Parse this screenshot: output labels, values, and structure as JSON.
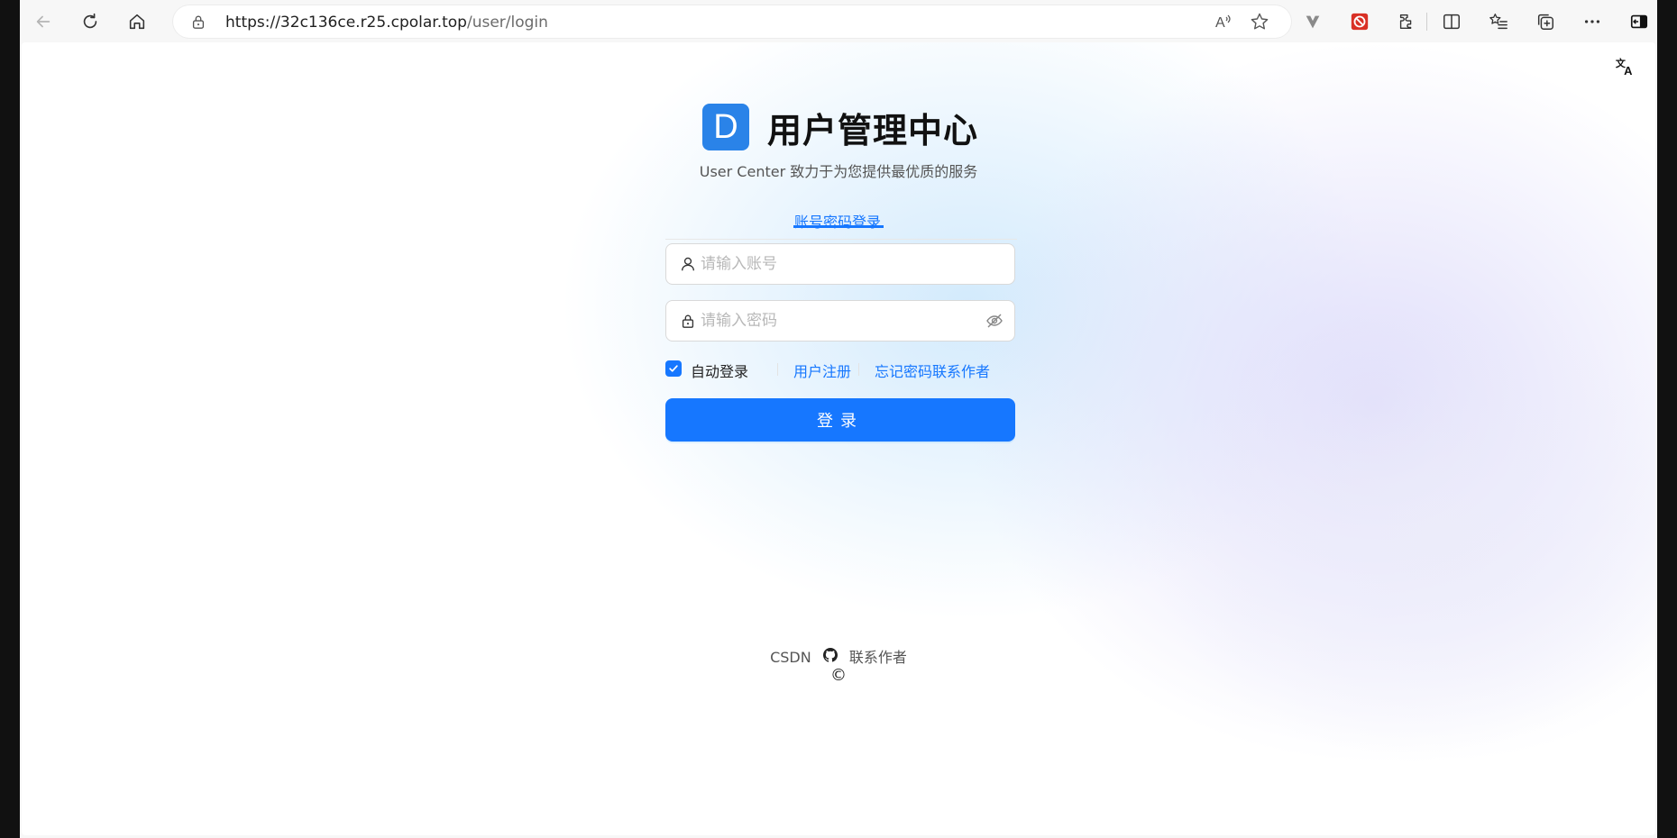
{
  "browser": {
    "url_host": "https://32c136ce.r25.cpolar.top",
    "url_path": "/user/login",
    "icons": [
      "back-icon",
      "refresh-icon",
      "home-icon",
      "lock-icon",
      "read-aloud-icon",
      "favorite-star-icon",
      "extension-v-icon",
      "extension-red-icon",
      "extensions-puzzle-icon",
      "split-screen-icon",
      "favorites-icon",
      "collections-icon",
      "more-icon",
      "sidebar-icon"
    ]
  },
  "page": {
    "logo_letter": "D",
    "title": "用户管理中心",
    "subtitle": "User Center 致力于为您提供最优质的服务",
    "tab_label": "账号密码登录",
    "username_placeholder": "请输入账号",
    "password_placeholder": "请输入密码",
    "auto_login_label": "自动登录",
    "register_link": "用户注册",
    "forgot_link": "忘记密码联系作者",
    "login_button": "登录",
    "footer": {
      "csdn": "CSDN",
      "contact": "联系作者",
      "copyright": "©"
    }
  },
  "colors": {
    "primary": "#1677ff",
    "logo_bg": "#2a83e8"
  }
}
